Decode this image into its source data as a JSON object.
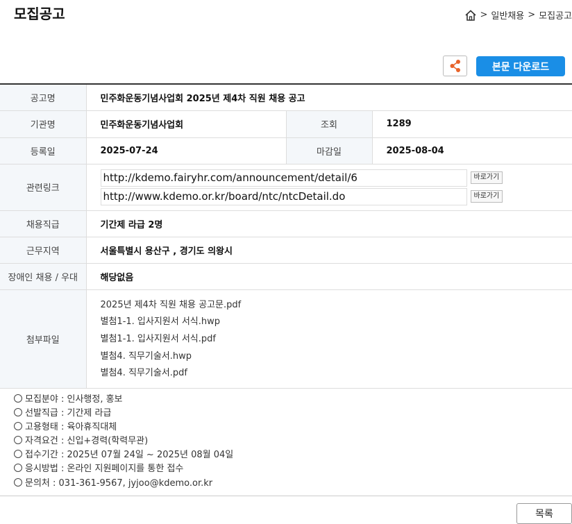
{
  "header": {
    "title": "모집공고",
    "breadcrumb": [
      "일반채용",
      "모집공고"
    ]
  },
  "actions": {
    "download_label": "본문 다운로드",
    "share_icon": "share-icon"
  },
  "info": {
    "title_label": "공고명",
    "title_value": "민주화운동기념사업회 2025년 제4차 직원 채용 공고",
    "org_label": "기관명",
    "org_value": "민주화운동기념사업회",
    "views_label": "조회",
    "views_value": "1289",
    "reg_label": "등록일",
    "reg_value": "2025-07-24",
    "deadline_label": "마감일",
    "deadline_value": "2025-08-04",
    "links_label": "관련링크",
    "links": [
      {
        "url": "http://kdemo.fairyhr.com/announcement/detail/6",
        "button": "바로가기"
      },
      {
        "url": "http://www.kdemo.or.kr/board/ntc/ntcDetail.do",
        "button": "바로가기"
      }
    ],
    "position_label": "채용직급",
    "position_value": "기간제 라급 2명",
    "location_label": "근무지역",
    "location_value": "서울특별시 용산구 , 경기도 의왕시",
    "disability_label": "장애인 채용 / 우대",
    "disability_value": "해당없음",
    "files_label": "첨부파일",
    "files": [
      "2025년 제4차 직원 채용 공고문.pdf",
      "별첨1-1. 입사지원서 서식.hwp",
      "별첨1-1. 입사지원서 서식.pdf",
      "별첨4. 직무기술서.hwp",
      "별첨4. 직무기술서.pdf"
    ]
  },
  "details": [
    "모집분야 : 인사행정, 홍보",
    "선발직급 : 기간제 라급",
    "고용형태 : 육아휴직대체",
    "자격요건 : 신입+경력(학력무관)",
    "접수기간 : 2025년 07월 24일 ~ 2025년 08월 04일",
    "응시방법 : 온라인 지원페이지를 통한 접수",
    "문의처 : 031-361-9567, jyjoo@kdemo.or.kr"
  ],
  "footer": {
    "list_label": "목록"
  }
}
